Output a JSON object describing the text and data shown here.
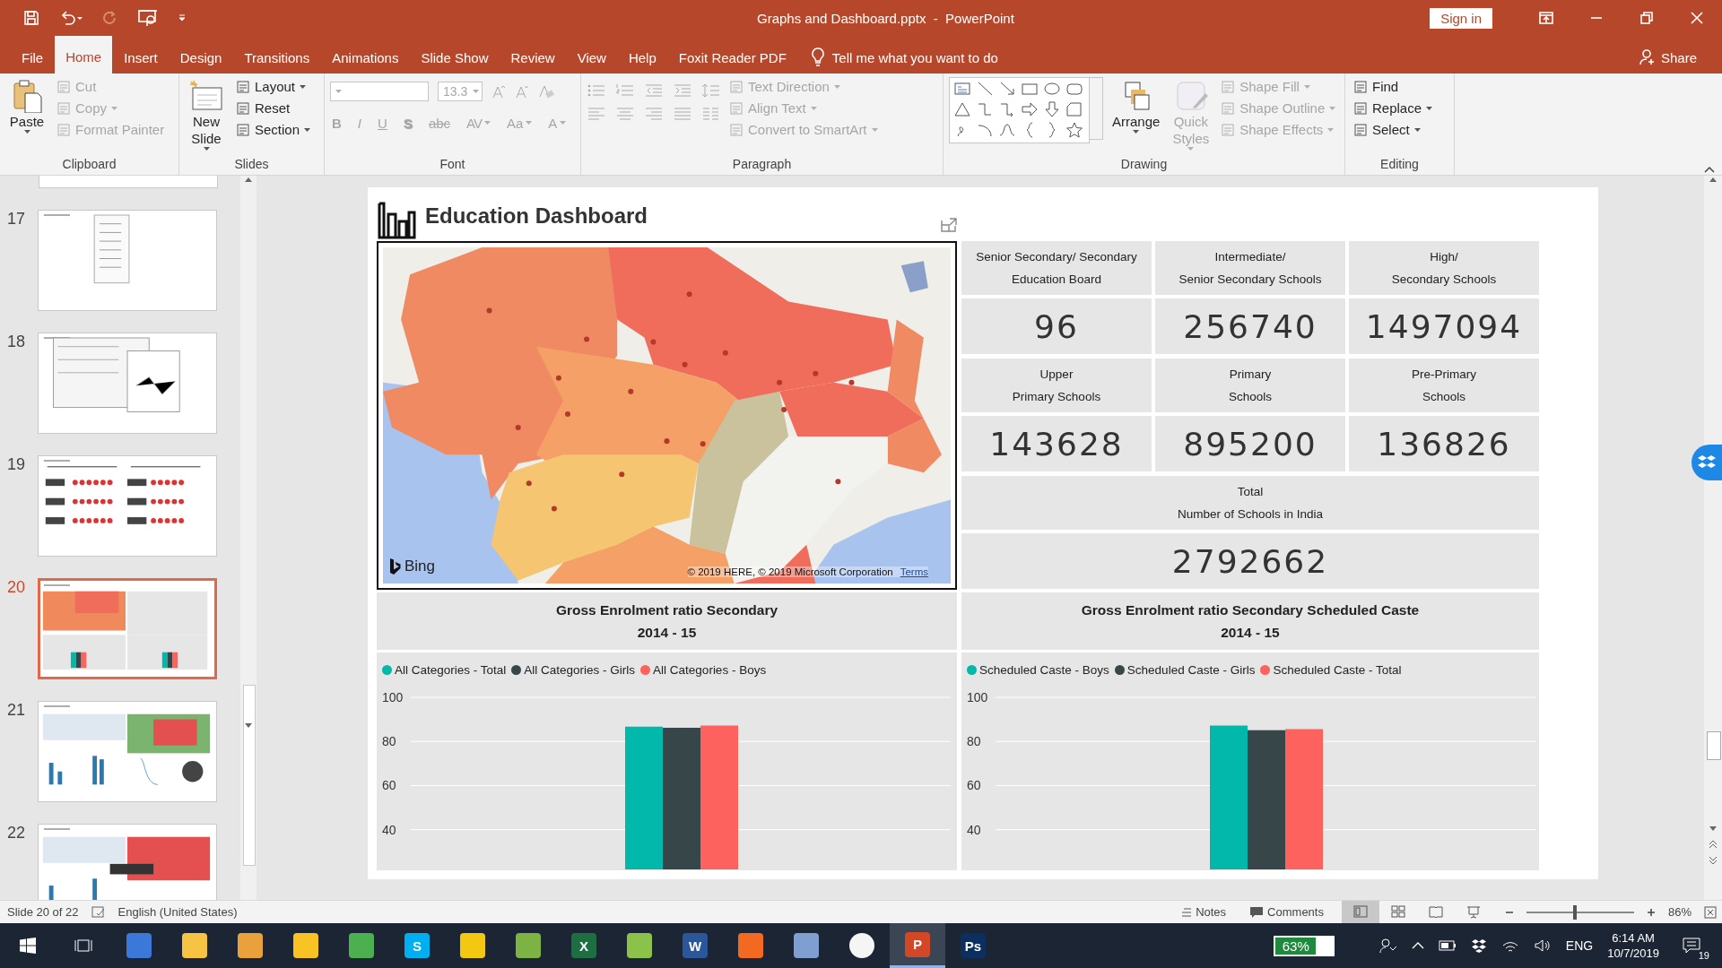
{
  "window": {
    "title": "Graphs and Dashboard.pptx  -  PowerPoint",
    "sign_in": "Sign in"
  },
  "menu_tabs": [
    {
      "label": "File",
      "selected": false
    },
    {
      "label": "Home",
      "selected": true
    },
    {
      "label": "Insert",
      "selected": false
    },
    {
      "label": "Design",
      "selected": false
    },
    {
      "label": "Transitions",
      "selected": false
    },
    {
      "label": "Animations",
      "selected": false
    },
    {
      "label": "Slide Show",
      "selected": false
    },
    {
      "label": "Review",
      "selected": false
    },
    {
      "label": "View",
      "selected": false
    },
    {
      "label": "Help",
      "selected": false
    },
    {
      "label": "Foxit Reader PDF",
      "selected": false
    }
  ],
  "tell_me": "Tell me what you want to do",
  "share": "Share",
  "ribbon": {
    "groups": [
      {
        "label": "Clipboard",
        "kind": "basic",
        "buttons": [
          {
            "label": "Paste",
            "kind": "large",
            "disabled": false,
            "dropdown": true
          },
          {
            "label": "Cut",
            "kind": "small",
            "disabled": true,
            "dropdown": false
          },
          {
            "label": "Copy",
            "kind": "small",
            "disabled": true,
            "dropdown": true
          },
          {
            "label": "Format Painter",
            "kind": "small",
            "disabled": true,
            "dropdown": false
          }
        ]
      },
      {
        "label": "Slides",
        "kind": "basic",
        "buttons": [
          {
            "label": "New\nSlide",
            "kind": "large",
            "disabled": false,
            "dropdown": true
          },
          {
            "label": "Layout",
            "kind": "small",
            "disabled": false,
            "dropdown": true
          },
          {
            "label": "Reset",
            "kind": "small",
            "disabled": false,
            "dropdown": false
          },
          {
            "label": "Section",
            "kind": "small",
            "disabled": false,
            "dropdown": true
          }
        ]
      },
      {
        "label": "Font",
        "kind": "font",
        "font_size": {
          "value": "13.3",
          "disabled": true
        },
        "buttons": [
          {
            "label": "B",
            "kind": "glyph",
            "disabled": true,
            "dropdown": false
          },
          {
            "label": "I",
            "kind": "glyph",
            "disabled": true,
            "dropdown": false
          },
          {
            "label": "U",
            "kind": "glyph",
            "disabled": true,
            "dropdown": false
          },
          {
            "label": "S",
            "kind": "glyph",
            "disabled": true,
            "dropdown": false
          },
          {
            "label": "abc",
            "kind": "glyph",
            "disabled": true,
            "dropdown": false
          },
          {
            "label": "AV",
            "kind": "glyph",
            "disabled": true,
            "dropdown": true
          },
          {
            "label": "Aa",
            "kind": "glyph",
            "disabled": true,
            "dropdown": true
          },
          {
            "label": "A",
            "kind": "glyph",
            "disabled": true,
            "dropdown": true
          }
        ]
      },
      {
        "label": "Paragraph",
        "kind": "paragraph",
        "buttons": [
          {
            "label": "Text Direction",
            "kind": "small",
            "disabled": true,
            "dropdown": true
          },
          {
            "label": "Align Text",
            "kind": "small",
            "disabled": true,
            "dropdown": true
          },
          {
            "label": "Convert to SmartArt",
            "kind": "small",
            "disabled": true,
            "dropdown": true
          }
        ]
      },
      {
        "label": "Drawing",
        "kind": "drawing",
        "buttons": [
          {
            "label": "Arrange",
            "kind": "large",
            "disabled": false,
            "dropdown": true
          },
          {
            "label": "Quick\nStyles",
            "kind": "large",
            "disabled": true,
            "dropdown": true
          },
          {
            "label": "Shape Fill",
            "kind": "small",
            "disabled": true,
            "dropdown": true
          },
          {
            "label": "Shape Outline",
            "kind": "small",
            "disabled": true,
            "dropdown": true
          },
          {
            "label": "Shape Effects",
            "kind": "small",
            "disabled": true,
            "dropdown": true
          }
        ]
      },
      {
        "label": "Editing",
        "kind": "basic",
        "buttons": [
          {
            "label": "Find",
            "kind": "small",
            "disabled": false,
            "dropdown": false
          },
          {
            "label": "Replace",
            "kind": "small",
            "disabled": false,
            "dropdown": true
          },
          {
            "label": "Select",
            "kind": "small",
            "disabled": false,
            "dropdown": true
          }
        ]
      }
    ]
  },
  "thumbnails": [
    {
      "number": "17",
      "selected": false
    },
    {
      "number": "18",
      "selected": false
    },
    {
      "number": "19",
      "selected": false
    },
    {
      "number": "20",
      "selected": true
    },
    {
      "number": "21",
      "selected": false
    },
    {
      "number": "22",
      "selected": false
    }
  ],
  "slide": {
    "title": "Education Dashboard",
    "map": {
      "provider": "Bing",
      "attribution": "© 2019 HERE, © 2019 Microsoft Corporation",
      "terms": "Terms"
    },
    "tiles": [
      {
        "label": "Senior Secondary/ Secondary\nEducation Board",
        "value": "96"
      },
      {
        "label": "Intermediate/\nSenior Secondary Schools",
        "value": "256740"
      },
      {
        "label": "High/\nSecondary Schools",
        "value": "1497094"
      },
      {
        "label": "Upper\nPrimary Schools",
        "value": "143628"
      },
      {
        "label": "Primary\nSchools",
        "value": "895200"
      },
      {
        "label": "Pre-Primary\nSchools",
        "value": "136826"
      }
    ],
    "total": {
      "label": "Total\nNumber of Schools in India",
      "value": "2792662"
    },
    "charts": [
      {
        "chart_data": {
          "type": "bar",
          "title": "Gross Enrolment ratio Secondary\n2014 - 15",
          "ylim": [
            22,
            100
          ],
          "yticks": [
            40,
            60,
            80,
            100
          ],
          "grid": true,
          "legend": true,
          "series": [
            {
              "name": "All Categories - Total",
              "color": "#01b8aa",
              "values": [
                86.7
              ]
            },
            {
              "name": "All Categories - Girls",
              "color": "#374649",
              "values": [
                86.2
              ]
            },
            {
              "name": "All Categories - Boys",
              "color": "#fd625e",
              "values": [
                87.2
              ]
            }
          ]
        }
      },
      {
        "chart_data": {
          "type": "bar",
          "title": "Gross Enrolment ratio Secondary Scheduled Caste\n2014 - 15",
          "ylim": [
            22,
            100
          ],
          "yticks": [
            40,
            60,
            80,
            100
          ],
          "grid": true,
          "legend": true,
          "series": [
            {
              "name": "Scheduled Caste - Boys",
              "color": "#01b8aa",
              "values": [
                87.2
              ]
            },
            {
              "name": "Scheduled Caste - Girls",
              "color": "#374649",
              "values": [
                85.1
              ]
            },
            {
              "name": "Scheduled Caste - Total",
              "color": "#fd625e",
              "values": [
                85.6
              ]
            }
          ]
        }
      }
    ]
  },
  "status_bar": {
    "slide_info": "Slide 20 of 22",
    "language": "English (United States)",
    "notes": "Notes",
    "comments": "Comments",
    "views": [
      {
        "selected": true
      },
      {
        "selected": false
      },
      {
        "selected": false
      },
      {
        "selected": false
      }
    ],
    "zoom": {
      "level": 0.43,
      "reading": "86%"
    }
  },
  "taskbar": {
    "apps": [
      {
        "color": "#3b78d8",
        "selected": false
      },
      {
        "color": "#f6c343",
        "selected": false
      },
      {
        "color": "#e9a23b",
        "selected": false
      },
      {
        "color": "#f7c325",
        "selected": false
      },
      {
        "color": "#4caf50",
        "selected": false
      },
      {
        "glyph": "S",
        "color": "#00aff0",
        "selected": false
      },
      {
        "color": "#f2c811",
        "selected": false
      },
      {
        "color": "#7cb342",
        "selected": false
      },
      {
        "glyph": "X",
        "color": "#1d6f42",
        "selected": false
      },
      {
        "color": "#8bc34a",
        "selected": false
      },
      {
        "glyph": "W",
        "color": "#2b579a",
        "selected": false
      },
      {
        "color": "#f26a21",
        "selected": false
      },
      {
        "color": "#7e9fd0",
        "selected": false
      },
      {
        "color": "#f5f5f5",
        "selected": false
      },
      {
        "glyph": "P",
        "color": "#d24726",
        "selected": true
      },
      {
        "glyph": "Ps",
        "color": "#0b2f5e",
        "selected": false
      }
    ],
    "battery": "63%",
    "language": "ENG",
    "time": "6:14 AM",
    "date": "10/7/2019",
    "notifications": "19"
  }
}
